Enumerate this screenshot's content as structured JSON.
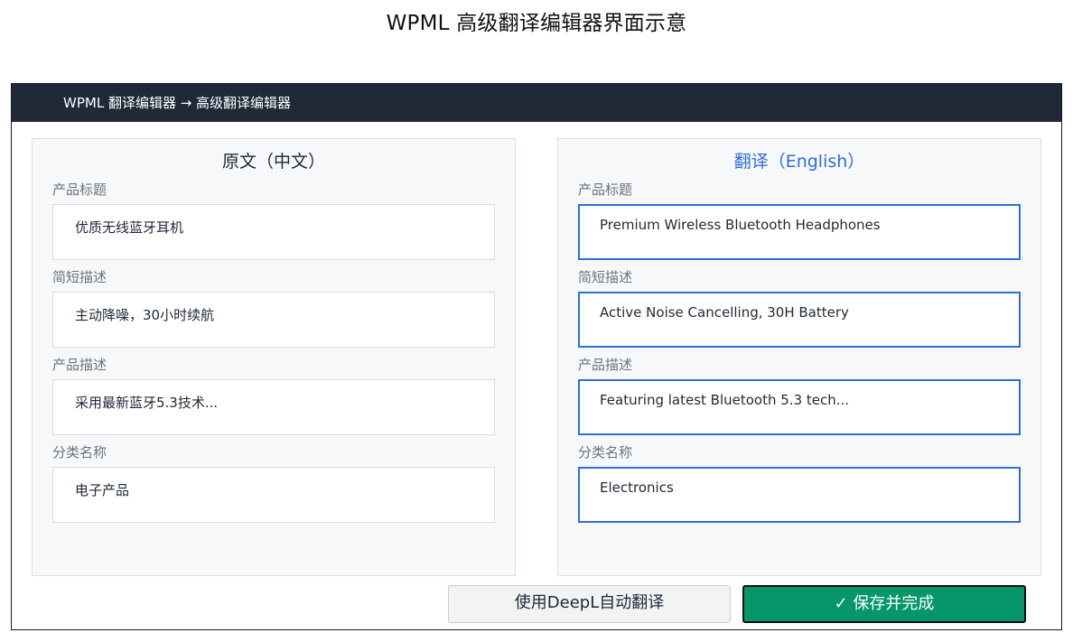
{
  "page_title": "WPML 高级翻译编辑器界面示意",
  "window": {
    "breadcrumb": "WPML 翻译编辑器 → 高级翻译编辑器"
  },
  "source_panel": {
    "heading": "原文（中文）",
    "fields": [
      {
        "label": "产品标题",
        "value": "优质无线蓝牙耳机"
      },
      {
        "label": "简短描述",
        "value": "主动降噪，30小时续航"
      },
      {
        "label": "产品描述",
        "value": "采用最新蓝牙5.3技术..."
      },
      {
        "label": "分类名称",
        "value": "电子产品"
      }
    ]
  },
  "translation_panel": {
    "heading": "翻译（English）",
    "fields": [
      {
        "label": "产品标题",
        "value": "Premium Wireless Bluetooth Headphones"
      },
      {
        "label": "简短描述",
        "value": "Active Noise Cancelling, 30H Battery"
      },
      {
        "label": "产品描述",
        "value": "Featuring latest Bluetooth 5.3 tech..."
      },
      {
        "label": "分类名称",
        "value": "Electronics"
      }
    ]
  },
  "actions": {
    "deepl_label": "使用DeepL自动翻译",
    "save_label": "✓ 保存并完成"
  },
  "colors": {
    "titlebar": "#1f2937",
    "accent_blue": "#2f6fd6",
    "save_green": "#059669"
  }
}
